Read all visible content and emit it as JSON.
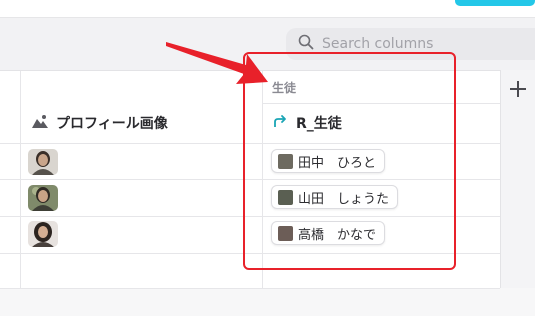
{
  "search": {
    "placeholder": "Search columns"
  },
  "table": {
    "group_label": "生徒",
    "columns": [
      {
        "label": "プロフィール画像",
        "icon": "image-icon"
      },
      {
        "label": "R_生徒",
        "icon": "link-arrow-icon"
      }
    ],
    "rows": [
      {
        "student": "田中　ひろと",
        "avatar_color": "#6d6a60"
      },
      {
        "student": "山田　しょうた",
        "avatar_color": "#5a5f52"
      },
      {
        "student": "高橋　かなで",
        "avatar_color": "#6c5d57"
      }
    ]
  },
  "colors": {
    "highlight": "#e8212a",
    "accent": "#23c7e8",
    "link_icon": "#1aa5b5"
  }
}
